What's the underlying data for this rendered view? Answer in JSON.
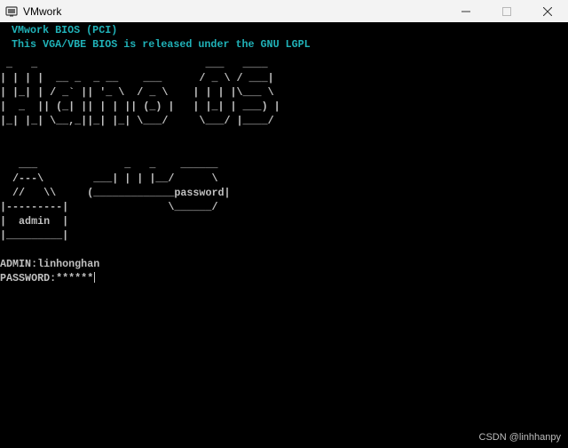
{
  "window": {
    "title": "VMwork",
    "minimize_icon": "minimize-icon",
    "maximize_icon": "maximize-icon",
    "close_icon": "close-icon"
  },
  "bios": {
    "line1": "VMwork BIOS (PCI)",
    "line2": "This VGA/VBE BIOS is released under the GNU LGPL"
  },
  "ascii_logo": [
    " _   _                           ___   ____",
    "| | | |  __ _  _ __    ___      / _ \\ / ___|",
    "| |_| | / _` || '_ \\  / _ \\    | | | |\\___ \\",
    "|  _  || (_| || | | || (_) |   | |_| | ___) |",
    "|_| |_| \\__,_||_| |_| \\___/     \\___/ |____/"
  ],
  "ascii_login": [
    "   ___              _   _    ______",
    "  /---\\        ___| | | |__/      \\",
    "  //   \\\\     (_____________password|",
    "|---------|                \\______/",
    "|  admin  |",
    "|_________|"
  ],
  "login": {
    "admin_line": "ADMIN:linhonghan",
    "password_line": "PASSWORD:******"
  },
  "watermark": "CSDN @linhhanpy",
  "colors": {
    "banner": "#20b2b8",
    "text": "#c8c8c8",
    "background": "#000000",
    "titlebar": "#f3f3f3"
  }
}
